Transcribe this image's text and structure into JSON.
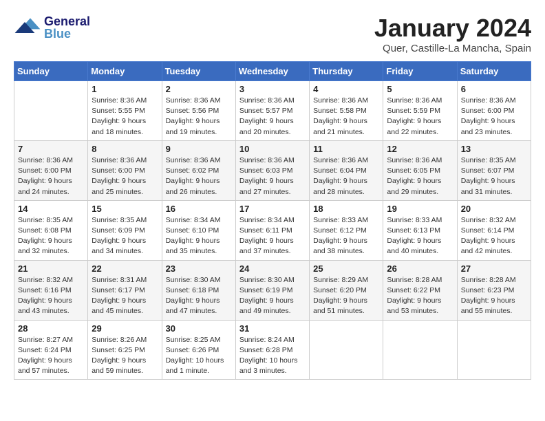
{
  "logo": {
    "general": "General",
    "blue": "Blue"
  },
  "title": "January 2024",
  "location": "Quer, Castille-La Mancha, Spain",
  "weekdays": [
    "Sunday",
    "Monday",
    "Tuesday",
    "Wednesday",
    "Thursday",
    "Friday",
    "Saturday"
  ],
  "weeks": [
    [
      {
        "day": "",
        "detail": ""
      },
      {
        "day": "1",
        "detail": "Sunrise: 8:36 AM\nSunset: 5:55 PM\nDaylight: 9 hours\nand 18 minutes."
      },
      {
        "day": "2",
        "detail": "Sunrise: 8:36 AM\nSunset: 5:56 PM\nDaylight: 9 hours\nand 19 minutes."
      },
      {
        "day": "3",
        "detail": "Sunrise: 8:36 AM\nSunset: 5:57 PM\nDaylight: 9 hours\nand 20 minutes."
      },
      {
        "day": "4",
        "detail": "Sunrise: 8:36 AM\nSunset: 5:58 PM\nDaylight: 9 hours\nand 21 minutes."
      },
      {
        "day": "5",
        "detail": "Sunrise: 8:36 AM\nSunset: 5:59 PM\nDaylight: 9 hours\nand 22 minutes."
      },
      {
        "day": "6",
        "detail": "Sunrise: 8:36 AM\nSunset: 6:00 PM\nDaylight: 9 hours\nand 23 minutes."
      }
    ],
    [
      {
        "day": "7",
        "detail": ""
      },
      {
        "day": "8",
        "detail": "Sunrise: 8:36 AM\nSunset: 6:00 PM\nDaylight: 9 hours\nand 25 minutes."
      },
      {
        "day": "9",
        "detail": "Sunrise: 8:36 AM\nSunset: 6:02 PM\nDaylight: 9 hours\nand 26 minutes."
      },
      {
        "day": "10",
        "detail": "Sunrise: 8:36 AM\nSunset: 6:03 PM\nDaylight: 9 hours\nand 27 minutes."
      },
      {
        "day": "11",
        "detail": "Sunrise: 8:36 AM\nSunset: 6:04 PM\nDaylight: 9 hours\nand 28 minutes."
      },
      {
        "day": "12",
        "detail": "Sunrise: 8:36 AM\nSunset: 6:05 PM\nDaylight: 9 hours\nand 29 minutes."
      },
      {
        "day": "13",
        "detail": "Sunrise: 8:35 AM\nSunset: 6:07 PM\nDaylight: 9 hours\nand 31 minutes."
      }
    ],
    [
      {
        "day": "14",
        "detail": ""
      },
      {
        "day": "15",
        "detail": "Sunrise: 8:35 AM\nSunset: 6:09 PM\nDaylight: 9 hours\nand 34 minutes."
      },
      {
        "day": "16",
        "detail": "Sunrise: 8:34 AM\nSunset: 6:10 PM\nDaylight: 9 hours\nand 35 minutes."
      },
      {
        "day": "17",
        "detail": "Sunrise: 8:34 AM\nSunset: 6:11 PM\nDaylight: 9 hours\nand 37 minutes."
      },
      {
        "day": "18",
        "detail": "Sunrise: 8:33 AM\nSunset: 6:12 PM\nDaylight: 9 hours\nand 38 minutes."
      },
      {
        "day": "19",
        "detail": "Sunrise: 8:33 AM\nSunset: 6:13 PM\nDaylight: 9 hours\nand 40 minutes."
      },
      {
        "day": "20",
        "detail": "Sunrise: 8:32 AM\nSunset: 6:14 PM\nDaylight: 9 hours\nand 42 minutes."
      }
    ],
    [
      {
        "day": "21",
        "detail": ""
      },
      {
        "day": "22",
        "detail": "Sunrise: 8:31 AM\nSunset: 6:17 PM\nDaylight: 9 hours\nand 45 minutes."
      },
      {
        "day": "23",
        "detail": "Sunrise: 8:30 AM\nSunset: 6:18 PM\nDaylight: 9 hours\nand 47 minutes."
      },
      {
        "day": "24",
        "detail": "Sunrise: 8:30 AM\nSunset: 6:19 PM\nDaylight: 9 hours\nand 49 minutes."
      },
      {
        "day": "25",
        "detail": "Sunrise: 8:29 AM\nSunset: 6:20 PM\nDaylight: 9 hours\nand 51 minutes."
      },
      {
        "day": "26",
        "detail": "Sunrise: 8:28 AM\nSunset: 6:22 PM\nDaylight: 9 hours\nand 53 minutes."
      },
      {
        "day": "27",
        "detail": "Sunrise: 8:28 AM\nSunset: 6:23 PM\nDaylight: 9 hours\nand 55 minutes."
      }
    ],
    [
      {
        "day": "28",
        "detail": "Sunrise: 8:27 AM\nSunset: 6:24 PM\nDaylight: 9 hours\nand 57 minutes."
      },
      {
        "day": "29",
        "detail": "Sunrise: 8:26 AM\nSunset: 6:25 PM\nDaylight: 9 hours\nand 59 minutes."
      },
      {
        "day": "30",
        "detail": "Sunrise: 8:25 AM\nSunset: 6:26 PM\nDaylight: 10 hours\nand 1 minute."
      },
      {
        "day": "31",
        "detail": "Sunrise: 8:24 AM\nSunset: 6:28 PM\nDaylight: 10 hours\nand 3 minutes."
      },
      {
        "day": "",
        "detail": ""
      },
      {
        "day": "",
        "detail": ""
      },
      {
        "day": "",
        "detail": ""
      }
    ]
  ],
  "week1_sun_detail": "Sunrise: 8:36 AM\nSunset: 6:00 PM\nDaylight: 9 hours\nand 24 minutes.",
  "week2_sun_detail": "Sunrise: 8:36 AM\nSunset: 6:00 PM\nDaylight: 9 hours\nand 24 minutes.",
  "week3_sun_detail": "Sunrise: 8:35 AM\nSunset: 6:08 PM\nDaylight: 9 hours\nand 32 minutes.",
  "week4_sun_detail": "Sunrise: 8:32 AM\nSunset: 6:16 PM\nDaylight: 9 hours\nand 43 minutes."
}
